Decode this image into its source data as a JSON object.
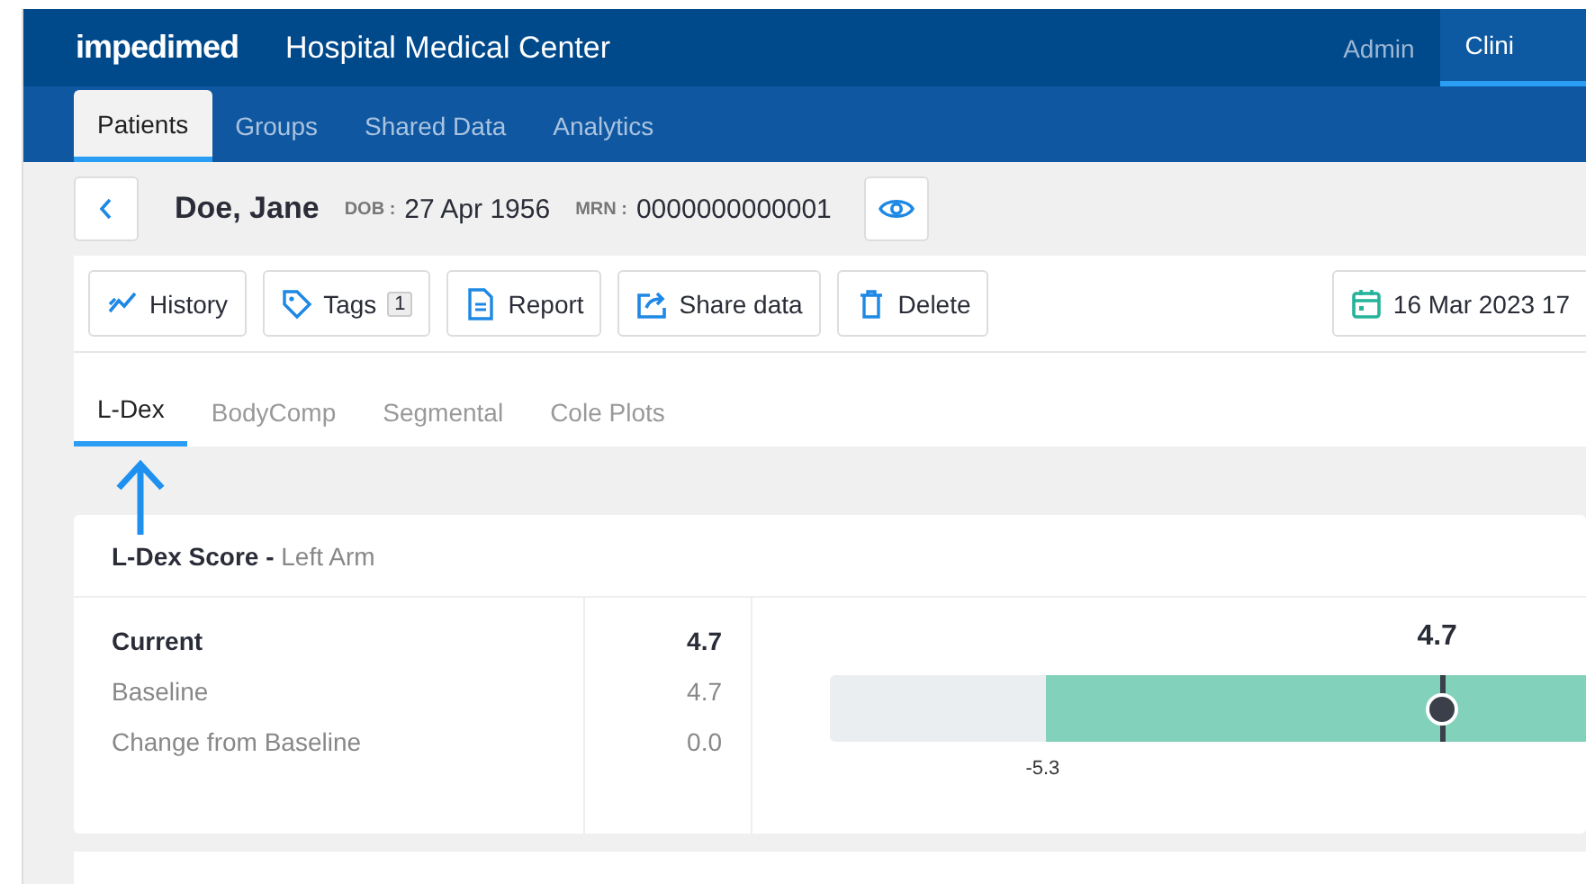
{
  "header": {
    "logo": "impedimed",
    "title": "Hospital Medical Center",
    "right_tabs": [
      {
        "label": "Admin",
        "selected": false
      },
      {
        "label": "Clini",
        "selected": true
      }
    ]
  },
  "nav": [
    {
      "label": "Patients",
      "selected": true
    },
    {
      "label": "Groups",
      "selected": false
    },
    {
      "label": "Shared Data",
      "selected": false
    },
    {
      "label": "Analytics",
      "selected": false
    }
  ],
  "patient": {
    "name": "Doe, Jane",
    "dob_label": "DOB :",
    "dob": "27 Apr 1956",
    "mrn_label": "MRN :",
    "mrn": "0000000000001"
  },
  "toolbar": [
    {
      "kind": "history",
      "label": "History"
    },
    {
      "kind": "tags",
      "label": "Tags",
      "badge": "1"
    },
    {
      "kind": "report",
      "label": "Report"
    },
    {
      "kind": "share",
      "label": "Share data"
    },
    {
      "kind": "delete",
      "label": "Delete"
    }
  ],
  "date": "16 Mar 2023 17",
  "tabs": [
    {
      "label": "L-Dex",
      "selected": true
    },
    {
      "label": "BodyComp",
      "selected": false
    },
    {
      "label": "Segmental",
      "selected": false
    },
    {
      "label": "Cole Plots",
      "selected": false
    }
  ],
  "score_card": {
    "title": "L-Dex Score -",
    "subtitle": "Left Arm",
    "rows": [
      {
        "label": "Current",
        "value": "4.7",
        "emphasis": true
      },
      {
        "label": "Baseline",
        "value": "4.7",
        "emphasis": false
      },
      {
        "label": "Change from Baseline",
        "value": "0.0",
        "emphasis": false
      }
    ],
    "gauge": {
      "marker_label": "4.7",
      "level": 0.81,
      "tick_label": "-5.3"
    }
  }
}
